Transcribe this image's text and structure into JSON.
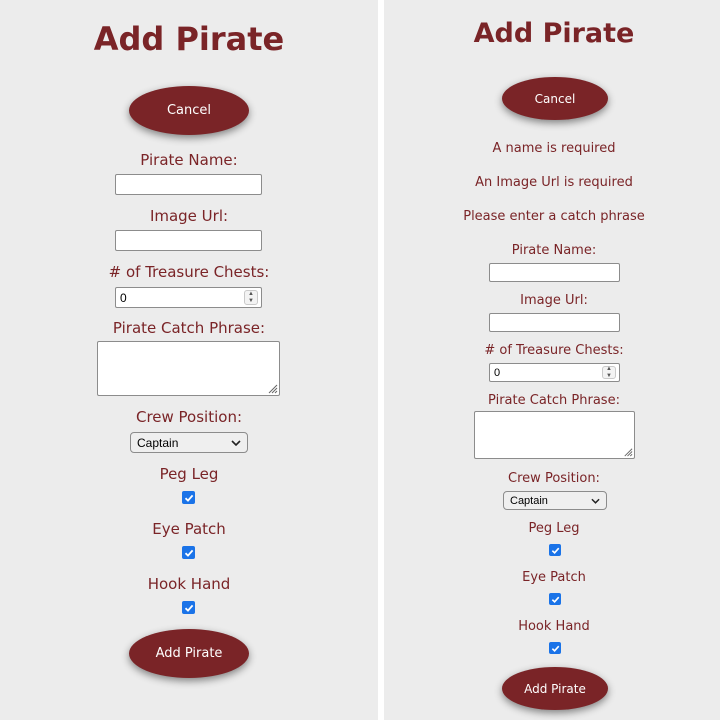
{
  "left_form": {
    "title": "Add Pirate",
    "cancel_label": "Cancel",
    "fields": {
      "name_label": "Pirate Name:",
      "image_label": "Image Url:",
      "treasure_label": "# of Treasure Chests:",
      "treasure_value": "0",
      "catch_phrase_label": "Pirate Catch Phrase:",
      "crew_label": "Crew Position:",
      "crew_selected": "Captain",
      "peg_leg_label": "Peg Leg",
      "peg_leg_checked": true,
      "eye_patch_label": "Eye Patch",
      "eye_patch_checked": true,
      "hook_hand_label": "Hook Hand",
      "hook_hand_checked": true
    },
    "submit_label": "Add Pirate"
  },
  "right_form": {
    "title": "Add Pirate",
    "cancel_label": "Cancel",
    "errors": [
      "A name is required",
      "An Image Url is required",
      "Please enter a catch phrase"
    ],
    "fields": {
      "name_label": "Pirate Name:",
      "image_label": "Image Url:",
      "treasure_label": "# of Treasure Chests:",
      "treasure_value": "0",
      "catch_phrase_label": "Pirate Catch Phrase:",
      "crew_label": "Crew Position:",
      "crew_selected": "Captain",
      "peg_leg_label": "Peg Leg",
      "peg_leg_checked": true,
      "eye_patch_label": "Eye Patch",
      "eye_patch_checked": true,
      "hook_hand_label": "Hook Hand",
      "hook_hand_checked": true
    },
    "submit_label": "Add Pirate"
  },
  "colors": {
    "accent": "#7a2427",
    "panel_background": "#ececec",
    "checkbox": "#1a73e8"
  }
}
